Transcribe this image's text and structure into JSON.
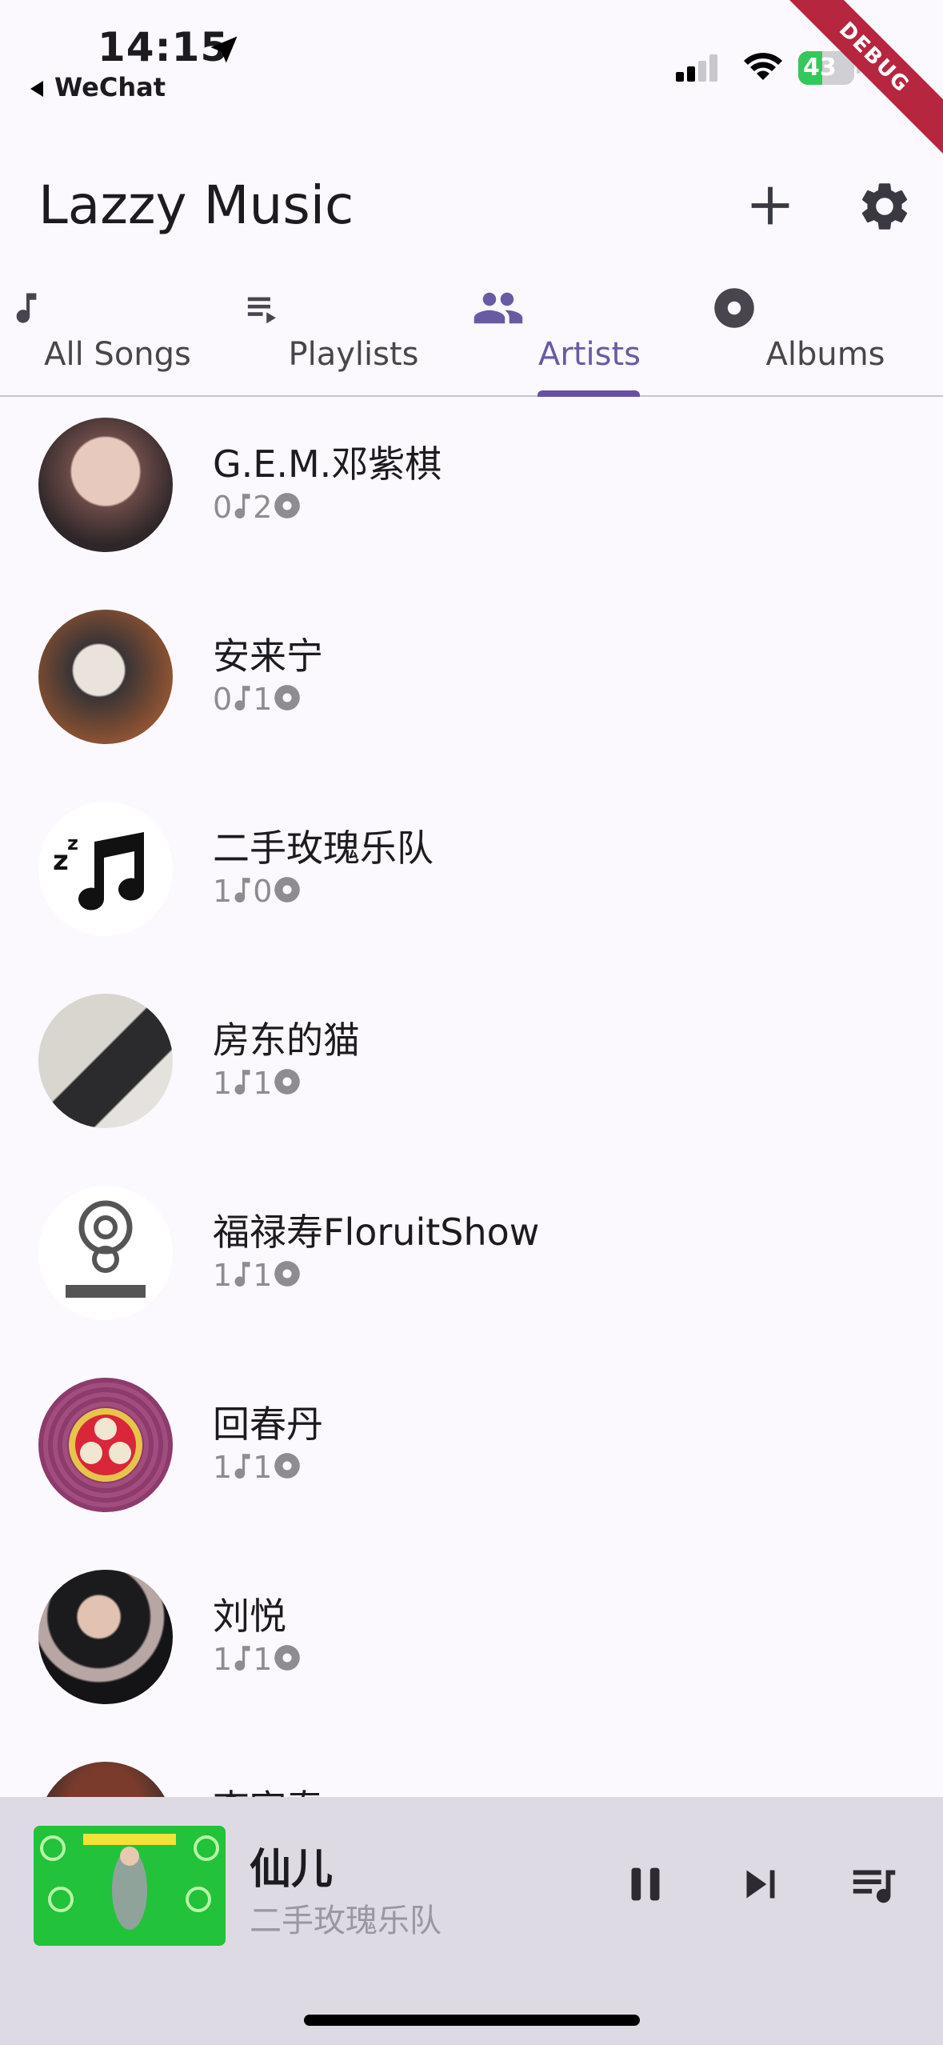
{
  "status": {
    "time": "14:15",
    "back_app": "WeChat",
    "battery": "43",
    "battery_level": 0.43
  },
  "debug_label": "DEBUG",
  "app": {
    "title": "Lazzy Music"
  },
  "tabs": [
    {
      "label": "All Songs",
      "icon": "music-note-icon"
    },
    {
      "label": "Playlists",
      "icon": "playlist-play-icon"
    },
    {
      "label": "Artists",
      "icon": "people-icon",
      "active": true
    },
    {
      "label": "Albums",
      "icon": "album-icon"
    }
  ],
  "artists": [
    {
      "name": "G.E.M.邓紫棋",
      "songs": "0",
      "albums": "2"
    },
    {
      "name": "安来宁",
      "songs": "0",
      "albums": "1"
    },
    {
      "name": "二手玫瑰乐队",
      "songs": "1",
      "albums": "0"
    },
    {
      "name": "房东的猫",
      "songs": "1",
      "albums": "1"
    },
    {
      "name": "福禄寿FloruitShow",
      "songs": "1",
      "albums": "1"
    },
    {
      "name": "回春丹",
      "songs": "1",
      "albums": "1"
    },
    {
      "name": "刘悦",
      "songs": "1",
      "albums": "1"
    },
    {
      "name": "李宇春",
      "songs": "",
      "albums": ""
    }
  ],
  "player": {
    "title": "仙儿",
    "artist": "二手玫瑰乐队"
  },
  "colors": {
    "accent": "#6750a4",
    "background": "#fbf8fe",
    "player_bg": "#dedae3"
  }
}
